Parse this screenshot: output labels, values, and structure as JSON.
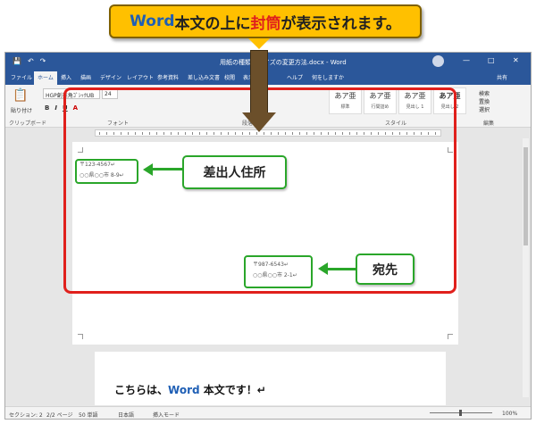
{
  "callout": {
    "part1": "Word",
    "part2": "本文の上に",
    "part3": "封筒",
    "part4": "が表示されます。"
  },
  "titlebar": {
    "doc_title": "用紙の種類とサイズの変更方法.docx - Word",
    "quick_access": [
      "💾",
      "↶",
      "↷"
    ],
    "window_controls": [
      "—",
      "□",
      "✕"
    ],
    "share": "共有"
  },
  "tabs": [
    "ファイル",
    "ホーム",
    "挿入",
    "描画",
    "デザイン",
    "レイアウト",
    "参考資料",
    "差し込み文書",
    "校閲",
    "表示",
    "ヘルプ",
    "何をしますか"
  ],
  "ribbon": {
    "paste_label": "貼り付け",
    "font_name": "HGP創英角ｺﾞｼｯｸUB",
    "font_size": "24",
    "format_buttons": [
      "B",
      "I",
      "U",
      "A"
    ],
    "groups": [
      "クリップボード",
      "フォント",
      "段落",
      "スタイル",
      "編集"
    ],
    "styles": [
      {
        "preview": "あア亜",
        "name": "標準"
      },
      {
        "preview": "あア亜",
        "name": "行間詰め"
      },
      {
        "preview": "あア亜",
        "name": "見出し 1"
      },
      {
        "preview": "あア亜",
        "name": "見出し 2"
      }
    ],
    "editing": [
      "検索",
      "置換",
      "選択"
    ]
  },
  "envelope": {
    "sender_postal": "〒123-4567↵",
    "sender_address": "○○県○○市 8-9↵",
    "recipient_postal": "〒987-6543↵",
    "recipient_address": "○○県○○市 2-1↵"
  },
  "labels": {
    "sender": "差出人住所",
    "recipient": "宛先"
  },
  "body": {
    "prefix": "こちらは、",
    "word": "Word",
    "suffix": " 本文です！↵"
  },
  "statusbar": {
    "section": "セクション: 2",
    "page": "2/2 ページ",
    "words": "50 単語",
    "language": "日本語",
    "mode": "挿入モード",
    "zoom": "100%"
  },
  "colors": {
    "title_blue": "#2b579a",
    "callout_gold": "#ffc000",
    "frame_red": "#e0201c",
    "label_green": "#2aa62a"
  }
}
